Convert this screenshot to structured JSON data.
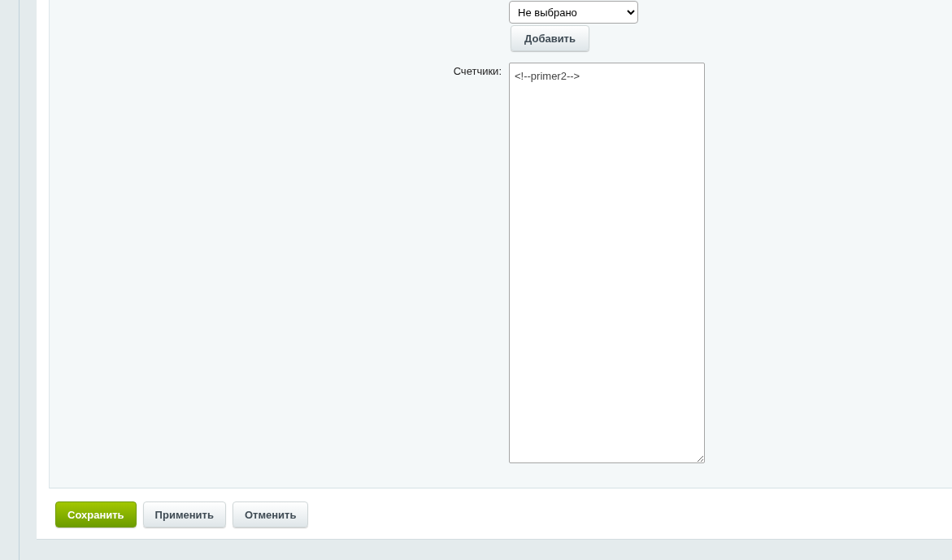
{
  "form": {
    "select": {
      "value": "Не выбрано"
    },
    "add_button": "Добавить",
    "counters": {
      "label": "Счетчики:",
      "value": "<!--primer2-->"
    }
  },
  "buttons": [
    {
      "label": "Сохранить",
      "kind": "primary"
    },
    {
      "label": "Применить",
      "kind": "default"
    },
    {
      "label": "Отменить",
      "kind": "default"
    }
  ]
}
